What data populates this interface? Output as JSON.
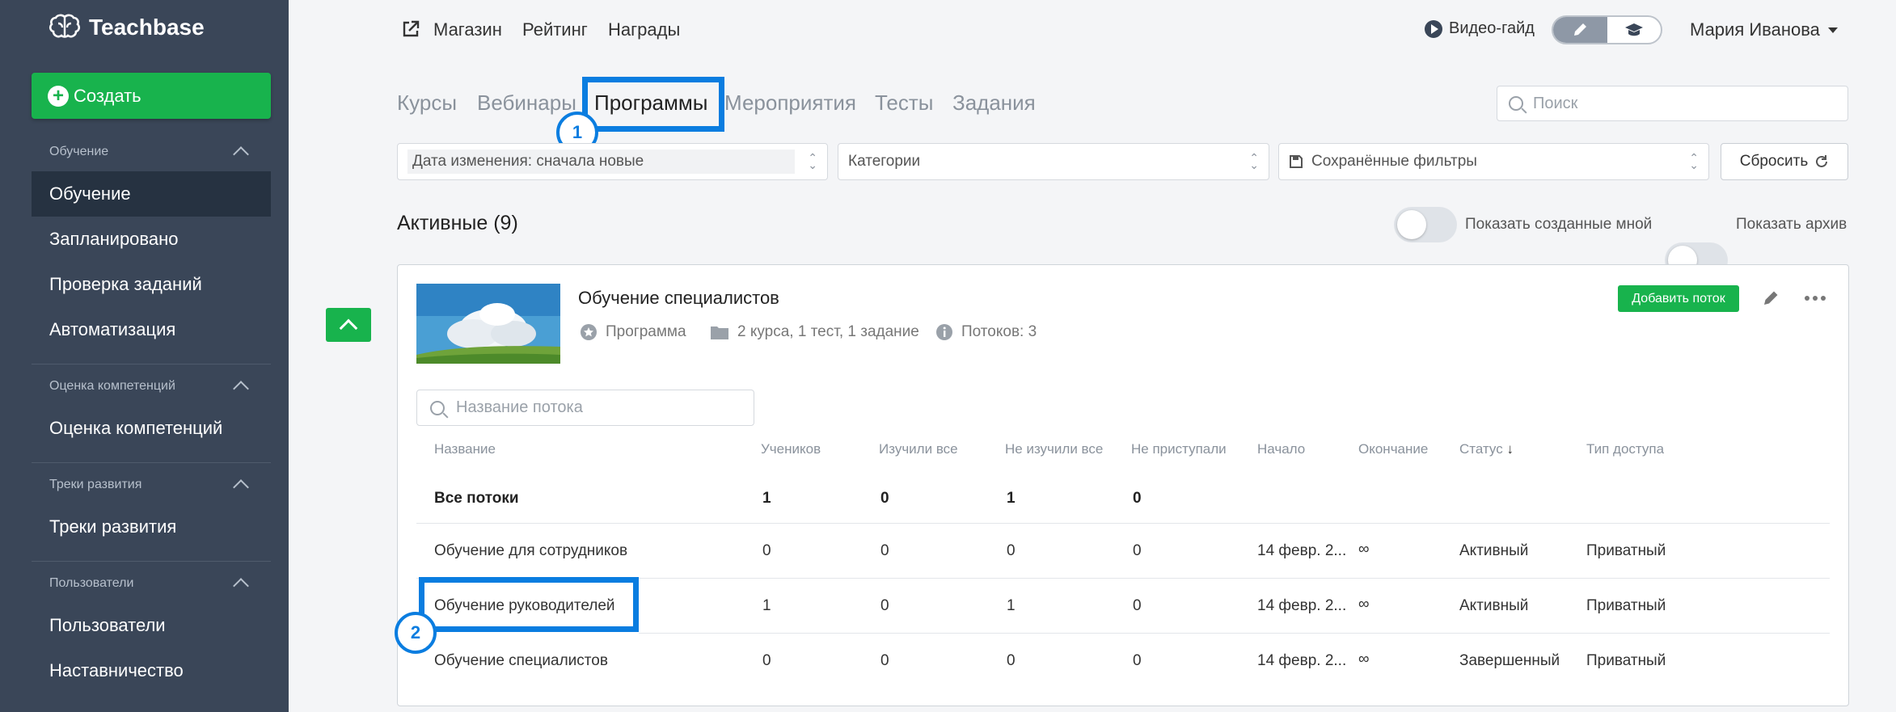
{
  "sidebar": {
    "brand": "Teachbase",
    "create_label": "Создать",
    "sections": [
      {
        "head": "Обучение",
        "items": [
          "Обучение",
          "Запланировано",
          "Проверка заданий",
          "Автоматизация"
        ]
      },
      {
        "head": "Оценка компетенций",
        "items": [
          "Оценка компетенций"
        ]
      },
      {
        "head": "Треки развития",
        "items": [
          "Треки развития"
        ]
      },
      {
        "head": "Пользователи",
        "items": [
          "Пользователи",
          "Наставничество"
        ]
      }
    ]
  },
  "topbar": {
    "links": [
      "Магазин",
      "Рейтинг",
      "Награды"
    ],
    "video_guide": "Видео-гайд",
    "user_name": "Мария Иванова"
  },
  "tabs": [
    "Курсы",
    "Вебинары",
    "Программы",
    "Мероприятия",
    "Тесты",
    "Задания"
  ],
  "search_placeholder": "Поиск",
  "filters": {
    "sort": "Дата изменения: сначала новые",
    "categories": "Категории",
    "saved": "Сохранённые фильтры",
    "reset": "Сбросить"
  },
  "active_heading": "Активные (9)",
  "toggles": {
    "mine": "Показать созданные мной",
    "archive": "Показать архив"
  },
  "program": {
    "title": "Обучение специалистов",
    "type": "Программа",
    "contents": "2 курса, 1 тест, 1 задание",
    "flows": "Потоков: 3",
    "add_flow": "Добавить поток",
    "flow_search_placeholder": "Название потока"
  },
  "table": {
    "headers": [
      "Название",
      "Учеников",
      "Изучили все",
      "Не изучили все",
      "Не приступали",
      "Начало",
      "Окончание",
      "Статус",
      "Тип доступа"
    ],
    "total": {
      "name": "Все потоки",
      "students": "1",
      "done": "0",
      "not_done": "1",
      "not_started": "0"
    },
    "rows": [
      {
        "name": "Обучение для сотрудников",
        "students": "0",
        "done": "0",
        "not_done": "0",
        "not_started": "0",
        "start": "14 февр. 2...",
        "end": "∞",
        "status": "Активный",
        "access": "Приватный"
      },
      {
        "name": "Обучение руководителей",
        "students": "1",
        "done": "0",
        "not_done": "1",
        "not_started": "0",
        "start": "14 февр. 2...",
        "end": "∞",
        "status": "Активный",
        "access": "Приватный"
      },
      {
        "name": "Обучение специалистов",
        "students": "0",
        "done": "0",
        "not_done": "0",
        "not_started": "0",
        "start": "14 февр. 2...",
        "end": "∞",
        "status": "Завершенный",
        "access": "Приватный"
      }
    ]
  },
  "annotations": [
    "1",
    "2"
  ],
  "colors": {
    "sidebar": "#3a4658",
    "accent_green": "#18b34d",
    "highlight_blue": "#0a7de0"
  }
}
